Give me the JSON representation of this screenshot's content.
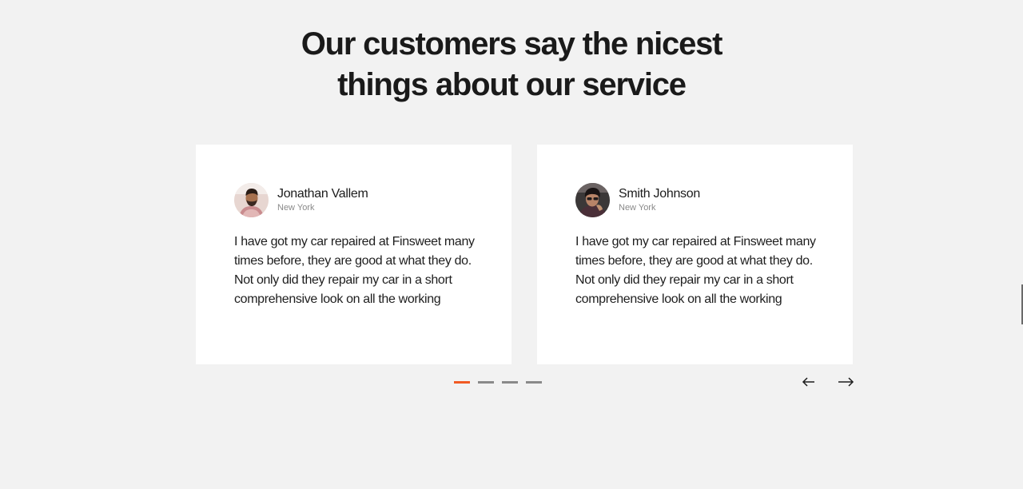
{
  "section": {
    "heading_line1": "Our customers say the nicest",
    "heading_line2": "things about our service"
  },
  "testimonials": [
    {
      "name": "Jonathan Vallem",
      "city": "New York",
      "avatar": "avatar-photo",
      "quote": "I have got my car repaired at Finsweet many times before, they are good at what they do. Not only did they repair my car in a short comprehensive look on all the working"
    },
    {
      "name": "Smith Johnson",
      "city": "New York",
      "avatar": "avatar-photo",
      "quote": "I have got my car repaired at Finsweet many times before, they are good at what they do. Not only did they repair my car in a short comprehensive look on all the working"
    }
  ],
  "pagination": {
    "count": 4,
    "active_index": 0
  },
  "navigation": {
    "prev_icon": "arrow-left-icon",
    "next_icon": "arrow-right-icon"
  },
  "colors": {
    "background": "#f2f2f2",
    "card": "#ffffff",
    "accent": "#f15a24",
    "inactive_dot": "#8a8a8a",
    "text": "#1c1c1c",
    "muted": "#8a8a8a"
  }
}
